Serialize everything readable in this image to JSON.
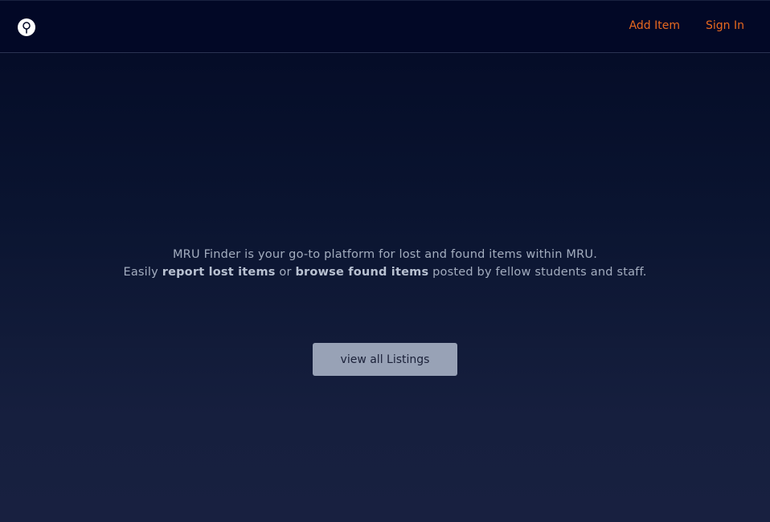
{
  "navbar": {
    "logo_icon": "magnifying-glass-icon",
    "links": [
      {
        "label": "Add Item"
      },
      {
        "label": "Sign In"
      }
    ]
  },
  "hero": {
    "line1": "MRU Finder is your go-to platform for lost and found items within MRU.",
    "line2_prefix": "Easily ",
    "line2_bold1": "report lost items",
    "line2_mid": " or ",
    "line2_bold2": "browse found items",
    "line2_suffix": " posted by fellow students and staff."
  },
  "cta": {
    "label": "view all Listings"
  },
  "colors": {
    "accent": "#e8691f",
    "navbar_bg": "#020826",
    "button_bg": "#98a2b6"
  }
}
